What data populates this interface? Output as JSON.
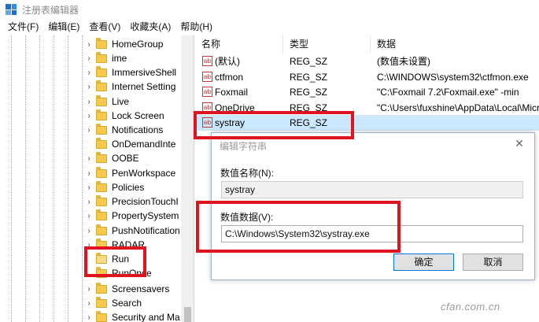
{
  "window": {
    "title": "注册表编辑器"
  },
  "menu": [
    "文件(F)",
    "编辑(E)",
    "查看(V)",
    "收藏夹(A)",
    "帮助(H)"
  ],
  "tree": {
    "items": [
      {
        "label": "HomeGroup",
        "expander": "›"
      },
      {
        "label": "ime",
        "expander": "›"
      },
      {
        "label": "ImmersiveShell",
        "expander": "›"
      },
      {
        "label": "Internet Setting",
        "expander": "›"
      },
      {
        "label": "Live",
        "expander": "›"
      },
      {
        "label": "Lock Screen",
        "expander": "›"
      },
      {
        "label": "Notifications",
        "expander": "›"
      },
      {
        "label": "OnDemandInte",
        "expander": ""
      },
      {
        "label": "OOBE",
        "expander": "›"
      },
      {
        "label": "PenWorkspace",
        "expander": "›"
      },
      {
        "label": "Policies",
        "expander": "›"
      },
      {
        "label": "PrecisionTouchI",
        "expander": "›"
      },
      {
        "label": "PropertySystem",
        "expander": "›"
      },
      {
        "label": "PushNotification",
        "expander": "›"
      },
      {
        "label": "RADAR",
        "expander": "›"
      },
      {
        "label": "Run",
        "expander": "",
        "selected": true
      },
      {
        "label": "RunOnce",
        "expander": ""
      },
      {
        "label": "Screensavers",
        "expander": "›"
      },
      {
        "label": "Search",
        "expander": "›"
      },
      {
        "label": "Security and Ma",
        "expander": "›"
      }
    ]
  },
  "list": {
    "columns": [
      "名称",
      "类型",
      "数据"
    ],
    "rows": [
      {
        "name": "(默认)",
        "type": "REG_SZ",
        "data": "(数值未设置)"
      },
      {
        "name": "ctfmon",
        "type": "REG_SZ",
        "data": "C:\\WINDOWS\\system32\\ctfmon.exe"
      },
      {
        "name": "Foxmail",
        "type": "REG_SZ",
        "data": "\"C:\\Foxmail 7.2\\Foxmail.exe\" -min"
      },
      {
        "name": "OneDrive",
        "type": "REG_SZ",
        "data": "\"C:\\Users\\fuxshine\\AppData\\Local\\Micr"
      },
      {
        "name": "systray",
        "type": "REG_SZ",
        "data": "",
        "selected": true
      }
    ],
    "icon": "ab"
  },
  "dialog": {
    "title": "编辑字符串",
    "close": "✕",
    "name_label": "数值名称(N):",
    "name_value": "systray",
    "data_label": "数值数据(V):",
    "data_value": "C:\\Windows\\System32\\systray.exe",
    "ok": "确定",
    "cancel": "取消"
  },
  "highlight_color": "#e0141e",
  "watermark": "cfan.com.cn"
}
